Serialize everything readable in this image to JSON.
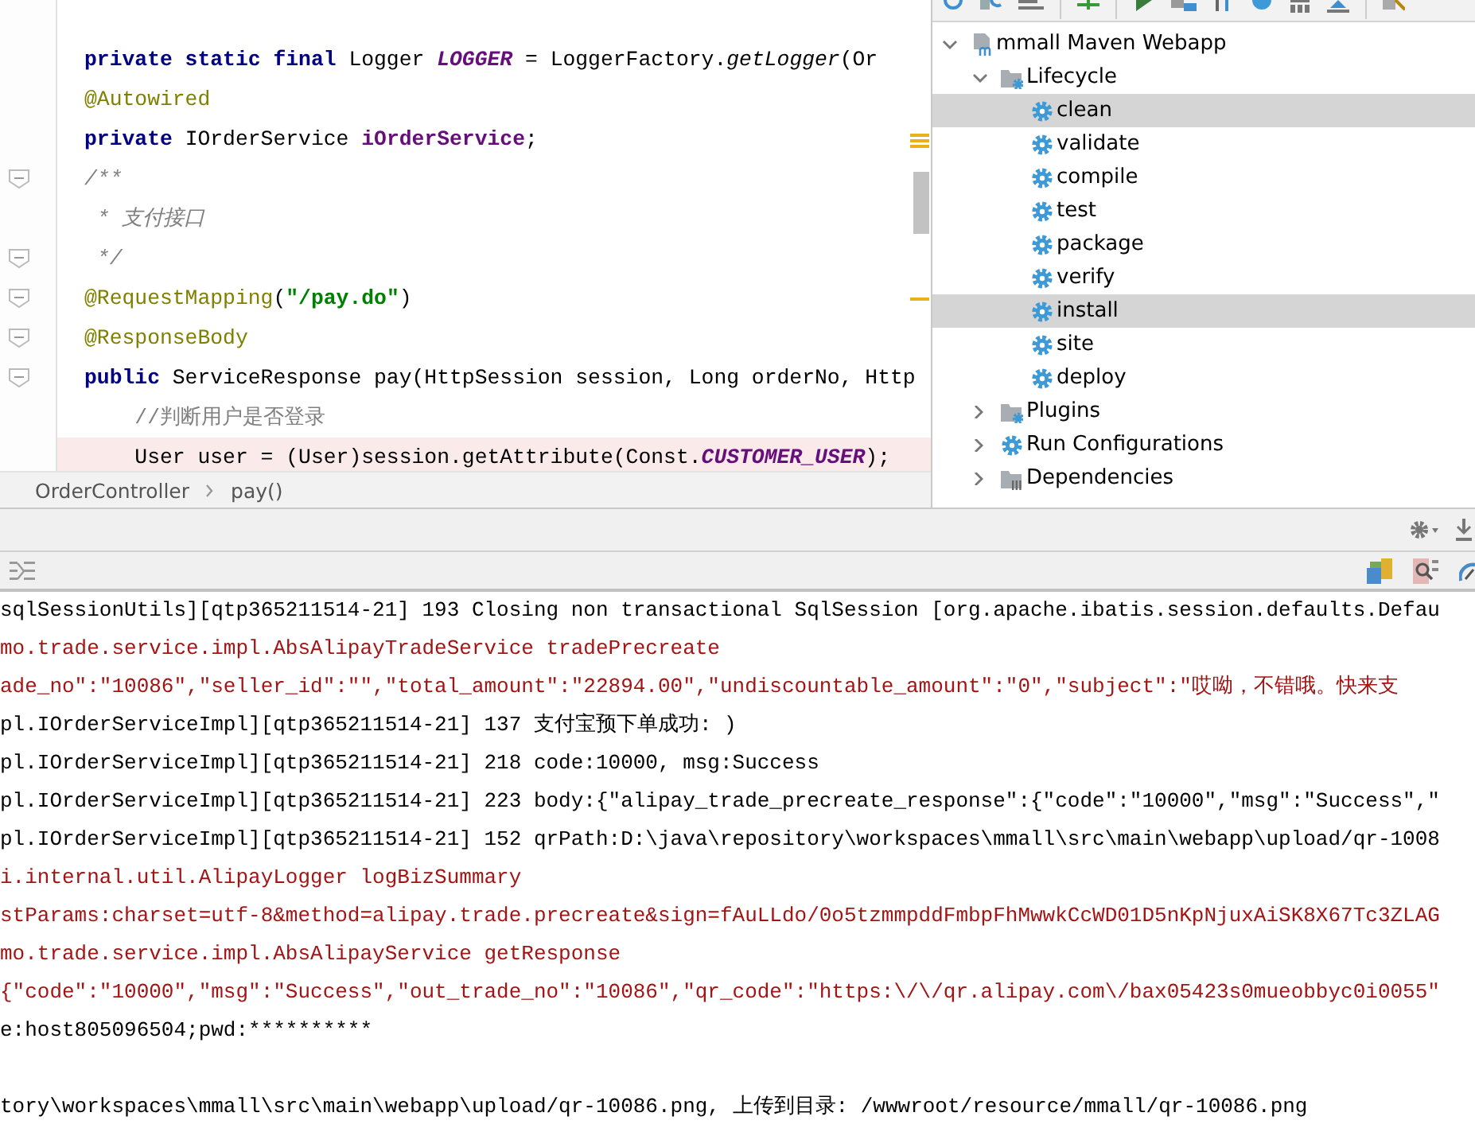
{
  "editor": {
    "lines": [
      {
        "fold_marker": false,
        "highlighted": false,
        "tokens": [
          {
            "kind": "keyword",
            "text": "private static final"
          },
          {
            "kind": "plain",
            "text": " Logger "
          },
          {
            "kind": "static",
            "text": "LOGGER"
          },
          {
            "kind": "plain",
            "text": " = LoggerFactory."
          },
          {
            "kind": "italic",
            "text": "getLogger"
          },
          {
            "kind": "plain",
            "text": "(Or"
          }
        ]
      },
      {
        "fold_marker": false,
        "highlighted": false,
        "tokens": [
          {
            "kind": "annotation",
            "text": "@Autowired"
          }
        ]
      },
      {
        "fold_marker": false,
        "highlighted": false,
        "tokens": [
          {
            "kind": "keyword",
            "text": "private"
          },
          {
            "kind": "plain",
            "text": " IOrderService "
          },
          {
            "kind": "field",
            "text": "iOrderService"
          },
          {
            "kind": "plain",
            "text": ";"
          }
        ]
      },
      {
        "fold_marker": true,
        "highlighted": false,
        "tokens": [
          {
            "kind": "comment",
            "text": "/**"
          }
        ]
      },
      {
        "fold_marker": false,
        "highlighted": false,
        "tokens": [
          {
            "kind": "comment",
            "text": " * 支付接口"
          }
        ]
      },
      {
        "fold_marker": true,
        "highlighted": false,
        "tokens": [
          {
            "kind": "comment",
            "text": " */"
          }
        ]
      },
      {
        "fold_marker": true,
        "highlighted": false,
        "tokens": [
          {
            "kind": "annotation",
            "text": "@RequestMapping"
          },
          {
            "kind": "plain",
            "text": "("
          },
          {
            "kind": "string",
            "text": "\"/pay.do\""
          },
          {
            "kind": "plain",
            "text": ")"
          }
        ]
      },
      {
        "fold_marker": true,
        "highlighted": false,
        "tokens": [
          {
            "kind": "annotation",
            "text": "@ResponseBody"
          }
        ]
      },
      {
        "fold_marker": true,
        "highlighted": false,
        "tokens": [
          {
            "kind": "keyword",
            "text": "public"
          },
          {
            "kind": "plain",
            "text": " ServiceResponse pay(HttpSession session, Long orderNo, Http"
          }
        ]
      },
      {
        "fold_marker": false,
        "highlighted": false,
        "tokens": [
          {
            "kind": "line_comment",
            "text": "    //判断用户是否登录"
          }
        ]
      },
      {
        "fold_marker": false,
        "highlighted": true,
        "tokens": [
          {
            "kind": "plain",
            "text": "    User user = (User)session.getAttribute(Const."
          },
          {
            "kind": "static",
            "text": "CUSTOMER_USER"
          },
          {
            "kind": "plain",
            "text": ");"
          }
        ]
      }
    ],
    "breadcrumb": [
      {
        "text": "OrderController"
      },
      {
        "text": "pay()"
      }
    ]
  },
  "maven": {
    "tree": [
      {
        "label": "mmall Maven Webapp",
        "kind": "project",
        "expanded": true,
        "selected": false,
        "children": [
          {
            "label": "Lifecycle",
            "kind": "folder_gear",
            "expanded": true,
            "selected": false,
            "children": [
              {
                "label": "clean",
                "kind": "gear",
                "selected": true
              },
              {
                "label": "validate",
                "kind": "gear",
                "selected": false
              },
              {
                "label": "compile",
                "kind": "gear",
                "selected": false
              },
              {
                "label": "test",
                "kind": "gear",
                "selected": false
              },
              {
                "label": "package",
                "kind": "gear",
                "selected": false
              },
              {
                "label": "verify",
                "kind": "gear",
                "selected": false
              },
              {
                "label": "install",
                "kind": "gear",
                "selected": true
              },
              {
                "label": "site",
                "kind": "gear",
                "selected": false
              },
              {
                "label": "deploy",
                "kind": "gear",
                "selected": false
              }
            ]
          },
          {
            "label": "Plugins",
            "kind": "folder_gear",
            "expanded": false,
            "selected": false
          },
          {
            "label": "Run Configurations",
            "kind": "gear",
            "expanded": false,
            "selected": false
          },
          {
            "label": "Dependencies",
            "kind": "folder_lib",
            "expanded": false,
            "selected": false
          }
        ]
      }
    ]
  },
  "console": {
    "lines": [
      {
        "kind": "out",
        "text": "sqlSessionUtils][qtp365211514-21] 193 Closing non transactional SqlSession [org.apache.ibatis.session.defaults.Defau"
      },
      {
        "kind": "err",
        "text": "mo.trade.service.impl.AbsAlipayTradeService tradePrecreate"
      },
      {
        "kind": "err",
        "text": "ade_no\":\"10086\",\"seller_id\":\"\",\"total_amount\":\"22894.00\",\"undiscountable_amount\":\"0\",\"subject\":\"哎呦，不错哦。快来支"
      },
      {
        "kind": "out",
        "text": "pl.IOrderServiceImpl][qtp365211514-21] 137 支付宝预下单成功: )"
      },
      {
        "kind": "out",
        "text": "pl.IOrderServiceImpl][qtp365211514-21] 218 code:10000, msg:Success"
      },
      {
        "kind": "out",
        "text": "pl.IOrderServiceImpl][qtp365211514-21] 223 body:{\"alipay_trade_precreate_response\":{\"code\":\"10000\",\"msg\":\"Success\",\""
      },
      {
        "kind": "out",
        "text": "pl.IOrderServiceImpl][qtp365211514-21] 152 qrPath:D:\\java\\repository\\workspaces\\mmall\\src\\main\\webapp\\upload/qr-1008"
      },
      {
        "kind": "err",
        "text": "i.internal.util.AlipayLogger logBizSummary"
      },
      {
        "kind": "err",
        "text": "stParams:charset=utf-8&method=alipay.trade.precreate&sign=fAuLLdo/0o5tzmmpddFmbpFhMwwkCcWD01D5nKpNjuxAiSK8X67Tc3ZLAG"
      },
      {
        "kind": "err",
        "text": "mo.trade.service.impl.AbsAlipayService getResponse"
      },
      {
        "kind": "err",
        "text": "{\"code\":\"10000\",\"msg\":\"Success\",\"out_trade_no\":\"10086\",\"qr_code\":\"https:\\/\\/qr.alipay.com\\/bax05423s0mueobbyc0i0055\""
      },
      {
        "kind": "out",
        "text": "e:host805096504;pwd:**********"
      },
      {
        "kind": "blank"
      },
      {
        "kind": "out",
        "text": "tory\\workspaces\\mmall\\src\\main\\webapp\\upload/qr-10086.png, 上传到目录: /wwwroot/resource/mmall/qr-10086.png"
      }
    ]
  }
}
